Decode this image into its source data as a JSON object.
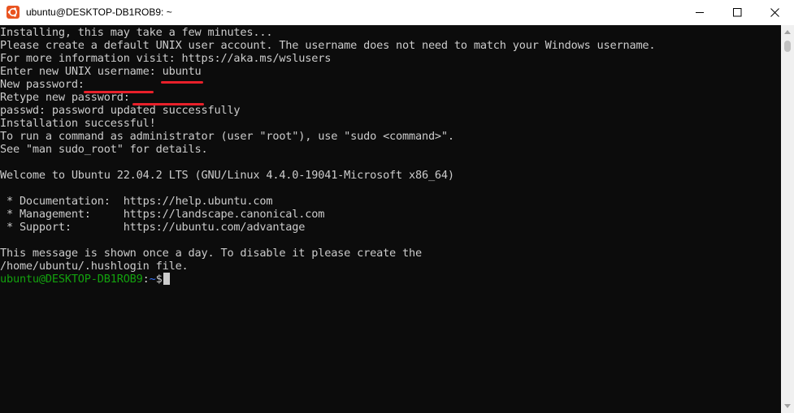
{
  "window": {
    "title": "ubuntu@DESKTOP-DB1ROB9: ~",
    "icon": "ubuntu-logo-icon",
    "controls": [
      "minimize-icon",
      "maximize-icon",
      "close-icon"
    ]
  },
  "terminal": {
    "lines": [
      "Installing, this may take a few minutes...",
      "Please create a default UNIX user account. The username does not need to match your Windows username.",
      "For more information visit: https://aka.ms/wslusers",
      "Enter new UNIX username: ubuntu",
      "New password:",
      "Retype new password:",
      "passwd: password updated successfully",
      "Installation successful!",
      "To run a command as administrator (user \"root\"), use \"sudo <command>\".",
      "See \"man sudo_root\" for details.",
      "",
      "Welcome to Ubuntu 22.04.2 LTS (GNU/Linux 4.4.0-19041-Microsoft x86_64)",
      "",
      " * Documentation:  https://help.ubuntu.com",
      " * Management:     https://landscape.canonical.com",
      " * Support:        https://ubuntu.com/advantage",
      "",
      "This message is shown once a day. To disable it please create the",
      "/home/ubuntu/.hushlogin file."
    ],
    "prompt": {
      "user_host": "ubuntu@DESKTOP-DB1ROB9",
      "separator": ":",
      "path": "~",
      "symbol": "$"
    }
  },
  "colors": {
    "background": "#0c0c0c",
    "text": "#cccccc",
    "prompt_user": "#13a10e",
    "prompt_path": "#3b78ff",
    "annotation": "#e8202a"
  }
}
